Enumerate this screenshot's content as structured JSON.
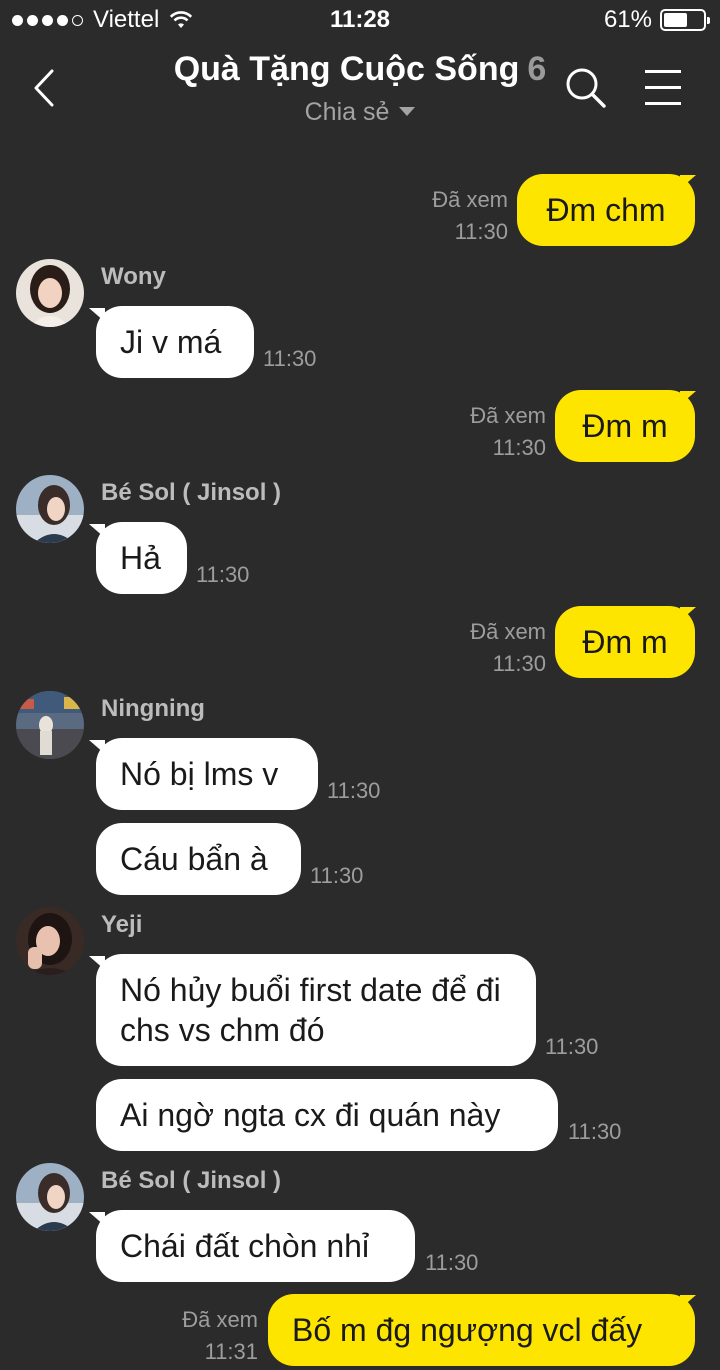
{
  "status": {
    "carrier": "Viettel",
    "time": "11:28",
    "battery": "61%",
    "battery_level": 0.61
  },
  "header": {
    "title": "Quà Tặng Cuộc Sống",
    "member_count": "6",
    "subtitle": "Chia sẻ"
  },
  "messages": [
    {
      "side": "out",
      "text": "Đm chm",
      "seen": "Đã xem",
      "time": "11:30"
    },
    {
      "side": "in",
      "sender": "Wony",
      "text": "Ji v má",
      "time": "11:30"
    },
    {
      "side": "out",
      "text": "Đm m",
      "seen": "Đã xem",
      "time": "11:30"
    },
    {
      "side": "in",
      "sender": "Bé Sol ( Jinsol )",
      "text": "Hả",
      "time": "11:30"
    },
    {
      "side": "out",
      "text": "Đm m",
      "seen": "Đã xem",
      "time": "11:30"
    },
    {
      "side": "in",
      "sender": "Ningning",
      "text": "Nó bị lms v",
      "time": "11:30"
    },
    {
      "side": "in",
      "text": "Cáu bẩn à",
      "time": "11:30"
    },
    {
      "side": "in",
      "sender": "Yeji",
      "text": "Nó hủy buổi first date để đi chs vs chm đó",
      "time": "11:30"
    },
    {
      "side": "in",
      "text": "Ai ngờ ngta cx đi quán này",
      "time": "11:30"
    },
    {
      "side": "in",
      "sender": "Bé Sol ( Jinsol )",
      "text": "Chái đất chòn nhỉ",
      "time": "11:30"
    },
    {
      "side": "out",
      "text": "Bố m đg ngượng vcl đấy",
      "seen": "Đã xem",
      "time": "11:31"
    }
  ]
}
